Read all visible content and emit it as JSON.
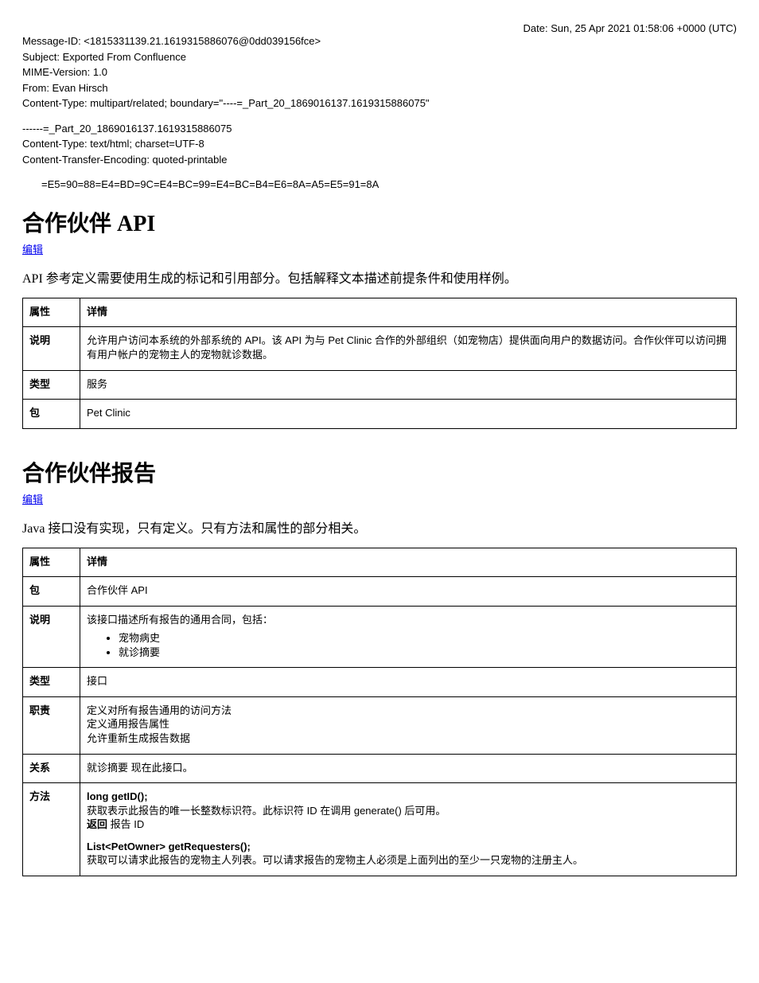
{
  "meta": {
    "date": "Date: Sun, 25 Apr 2021 01:58:06 +0000 (UTC)",
    "msgid": "Message-ID: <1815331139.21.1619315886076@0dd039156fce>",
    "subject": "Subject: Exported From Confluence",
    "mime": "MIME-Version: 1.0",
    "from": "From: Evan Hirsch",
    "ctype": "Content-Type: multipart/related; boundary=\"----=_Part_20_1869016137.1619315886075\"",
    "boundary1": "------=_Part_20_1869016137.1619315886075",
    "ctype2": "Content-Type: text/html; charset=UTF-8",
    "cenc": "Content-Transfer-Encoding: quoted-printable",
    "encoded": "=E5=90=88=E4=BD=9C=E4=BC=99=E4=BC=B4=E6=8A=A5=E5=91=8A"
  },
  "partnerApi": {
    "title": "合作伙伴 API",
    "edit_label": "编辑",
    "description": "API 参考定义需要使用生成的标记和引用部分。包括解释文本描述前提条件和使用样例。",
    "headers": {
      "property": "属性",
      "details": "详情"
    },
    "rows": [
      {
        "label": "说明",
        "text": "允许用户访问本系统的外部系统的 API。该 API 为与 Pet Clinic 合作的外部组织（如宠物店）提供面向用户的数据访问。合作伙伴可以访问拥有用户帐户的宠物主人的宠物就诊数据。"
      },
      {
        "label": "类型",
        "text": "服务"
      },
      {
        "label": "包",
        "text": "Pet Clinic"
      }
    ]
  },
  "reportApi": {
    "title": "合作伙伴报告",
    "edit_label": "编辑",
    "description": "Java 接口没有实现，只有定义。只有方法和属性的部分相关。",
    "headers": {
      "property": "属性",
      "details": "详情"
    },
    "rows": [
      {
        "label": "包",
        "text": "合作伙伴 API"
      },
      {
        "label": "说明",
        "text_lines": [
          "该接口描述所有报告的通用合同，包括："
        ],
        "list": [
          "宠物病史",
          "就诊摘要"
        ]
      },
      {
        "label": "类型",
        "text": "接口"
      },
      {
        "label": "职责",
        "text_lines": [
          "定义对所有报告通用的访问方法",
          "定义通用报告属性",
          "允许重新生成报告数据"
        ]
      },
      {
        "label": "关系",
        "text": "就诊摘要 现在此接口。"
      },
      {
        "label": "方法",
        "methods": [
          {
            "sig": "long getID();",
            "desc": "获取表示此报告的唯一长整数标识符。此标识符 ID 在调用 generate() 后可用。",
            "ret": "报告 ID",
            "ret_label": "返回"
          },
          {
            "sig": "List<PetOwner> getRequesters();",
            "desc": "获取可以请求此报告的宠物主人列表。可以请求报告的宠物主人必须是上面列出的至少一只宠物的注册主人。"
          }
        ]
      }
    ]
  }
}
